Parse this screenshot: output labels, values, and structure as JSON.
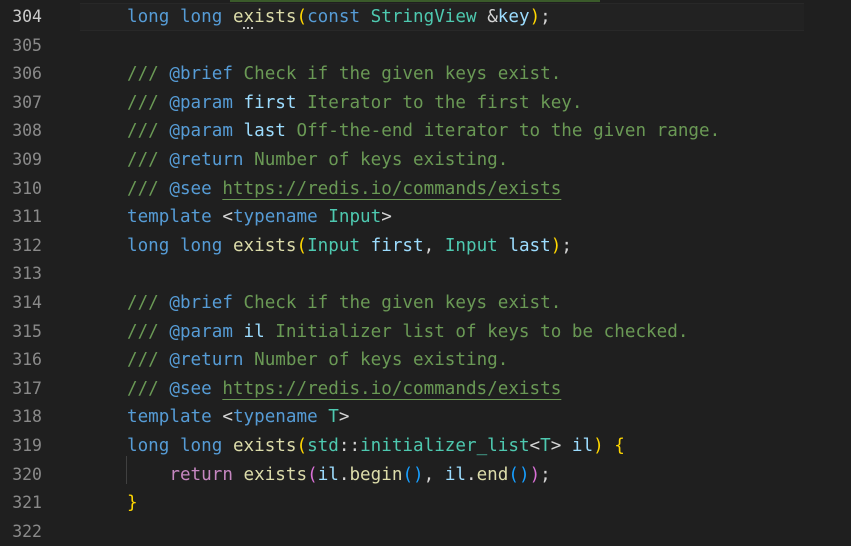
{
  "active_line": "304",
  "lines": [
    {
      "n": "304",
      "tokens": [
        {
          "t": "long long ",
          "c": "kw"
        },
        {
          "t": "e",
          "c": "fn"
        },
        {
          "t": "x",
          "c": "fn dots"
        },
        {
          "t": "ists",
          "c": "fn"
        },
        {
          "t": "(",
          "c": "b1"
        },
        {
          "t": "const ",
          "c": "kw"
        },
        {
          "t": "StringView ",
          "c": "ty"
        },
        {
          "t": "&",
          "c": "pn"
        },
        {
          "t": "key",
          "c": "pr"
        },
        {
          "t": ")",
          "c": "b1"
        },
        {
          "t": ";",
          "c": "pn"
        }
      ]
    },
    {
      "n": "305",
      "tokens": []
    },
    {
      "n": "306",
      "tokens": [
        {
          "t": "/// ",
          "c": "cm"
        },
        {
          "t": "@brief",
          "c": "tg"
        },
        {
          "t": " Check if the given keys exist.",
          "c": "cm"
        }
      ]
    },
    {
      "n": "307",
      "tokens": [
        {
          "t": "/// ",
          "c": "cm"
        },
        {
          "t": "@param",
          "c": "tg"
        },
        {
          "t": " ",
          "c": "cm"
        },
        {
          "t": "first",
          "c": "pr"
        },
        {
          "t": " Iterator to the first key.",
          "c": "cm"
        }
      ]
    },
    {
      "n": "308",
      "tokens": [
        {
          "t": "/// ",
          "c": "cm"
        },
        {
          "t": "@param",
          "c": "tg"
        },
        {
          "t": " ",
          "c": "cm"
        },
        {
          "t": "last",
          "c": "pr"
        },
        {
          "t": " Off-the-end iterator to the given range.",
          "c": "cm"
        }
      ]
    },
    {
      "n": "309",
      "tokens": [
        {
          "t": "/// ",
          "c": "cm"
        },
        {
          "t": "@return",
          "c": "tg"
        },
        {
          "t": " Number of keys existing.",
          "c": "cm"
        }
      ]
    },
    {
      "n": "310",
      "tokens": [
        {
          "t": "/// ",
          "c": "cm"
        },
        {
          "t": "@see",
          "c": "tg"
        },
        {
          "t": " ",
          "c": "cm"
        },
        {
          "t": "https://redis.io/commands/exists",
          "c": "url"
        }
      ]
    },
    {
      "n": "311",
      "tokens": [
        {
          "t": "template ",
          "c": "kw"
        },
        {
          "t": "<",
          "c": "pn"
        },
        {
          "t": "typename ",
          "c": "kw"
        },
        {
          "t": "Input",
          "c": "ty"
        },
        {
          "t": ">",
          "c": "pn"
        }
      ]
    },
    {
      "n": "312",
      "tokens": [
        {
          "t": "long long ",
          "c": "kw"
        },
        {
          "t": "exists",
          "c": "fn"
        },
        {
          "t": "(",
          "c": "b1"
        },
        {
          "t": "Input ",
          "c": "ty"
        },
        {
          "t": "first",
          "c": "pr"
        },
        {
          "t": ", ",
          "c": "pn"
        },
        {
          "t": "Input ",
          "c": "ty"
        },
        {
          "t": "last",
          "c": "pr"
        },
        {
          "t": ")",
          "c": "b1"
        },
        {
          "t": ";",
          "c": "pn"
        }
      ]
    },
    {
      "n": "313",
      "tokens": []
    },
    {
      "n": "314",
      "tokens": [
        {
          "t": "/// ",
          "c": "cm"
        },
        {
          "t": "@brief",
          "c": "tg"
        },
        {
          "t": " Check if the given keys exist.",
          "c": "cm"
        }
      ]
    },
    {
      "n": "315",
      "tokens": [
        {
          "t": "/// ",
          "c": "cm"
        },
        {
          "t": "@param",
          "c": "tg"
        },
        {
          "t": " ",
          "c": "cm"
        },
        {
          "t": "il",
          "c": "pr"
        },
        {
          "t": " Initializer list of keys to be checked.",
          "c": "cm"
        }
      ]
    },
    {
      "n": "316",
      "tokens": [
        {
          "t": "/// ",
          "c": "cm"
        },
        {
          "t": "@return",
          "c": "tg"
        },
        {
          "t": " Number of keys existing.",
          "c": "cm"
        }
      ]
    },
    {
      "n": "317",
      "tokens": [
        {
          "t": "/// ",
          "c": "cm"
        },
        {
          "t": "@see",
          "c": "tg"
        },
        {
          "t": " ",
          "c": "cm"
        },
        {
          "t": "https://redis.io/commands/exists",
          "c": "url"
        }
      ]
    },
    {
      "n": "318",
      "tokens": [
        {
          "t": "template ",
          "c": "kw"
        },
        {
          "t": "<",
          "c": "pn"
        },
        {
          "t": "typename ",
          "c": "kw"
        },
        {
          "t": "T",
          "c": "ty"
        },
        {
          "t": ">",
          "c": "pn"
        }
      ]
    },
    {
      "n": "319",
      "tokens": [
        {
          "t": "long long ",
          "c": "kw"
        },
        {
          "t": "exists",
          "c": "fn"
        },
        {
          "t": "(",
          "c": "b1"
        },
        {
          "t": "std",
          "c": "ty"
        },
        {
          "t": "::",
          "c": "pn"
        },
        {
          "t": "initializer_list",
          "c": "ty"
        },
        {
          "t": "<",
          "c": "pn"
        },
        {
          "t": "T",
          "c": "ty"
        },
        {
          "t": "> ",
          "c": "pn"
        },
        {
          "t": "il",
          "c": "pr"
        },
        {
          "t": ") ",
          "c": "b1"
        },
        {
          "t": "{",
          "c": "b1"
        }
      ]
    },
    {
      "n": "320",
      "tokens": [
        {
          "t": "    ",
          "c": "pn"
        },
        {
          "t": "return ",
          "c": "ct"
        },
        {
          "t": "exists",
          "c": "fn"
        },
        {
          "t": "(",
          "c": "b2"
        },
        {
          "t": "il",
          "c": "pr"
        },
        {
          "t": ".",
          "c": "pn"
        },
        {
          "t": "begin",
          "c": "fn"
        },
        {
          "t": "()",
          "c": "b3"
        },
        {
          "t": ", ",
          "c": "pn"
        },
        {
          "t": "il",
          "c": "pr"
        },
        {
          "t": ".",
          "c": "pn"
        },
        {
          "t": "end",
          "c": "fn"
        },
        {
          "t": "()",
          "c": "b3"
        },
        {
          "t": ")",
          "c": "b2"
        },
        {
          "t": ";",
          "c": "pn"
        }
      ]
    },
    {
      "n": "321",
      "tokens": [
        {
          "t": "}",
          "c": "b1"
        }
      ]
    },
    {
      "n": "322",
      "tokens": []
    }
  ],
  "icons": {
    "lightbulb": "lightbulb-icon"
  }
}
